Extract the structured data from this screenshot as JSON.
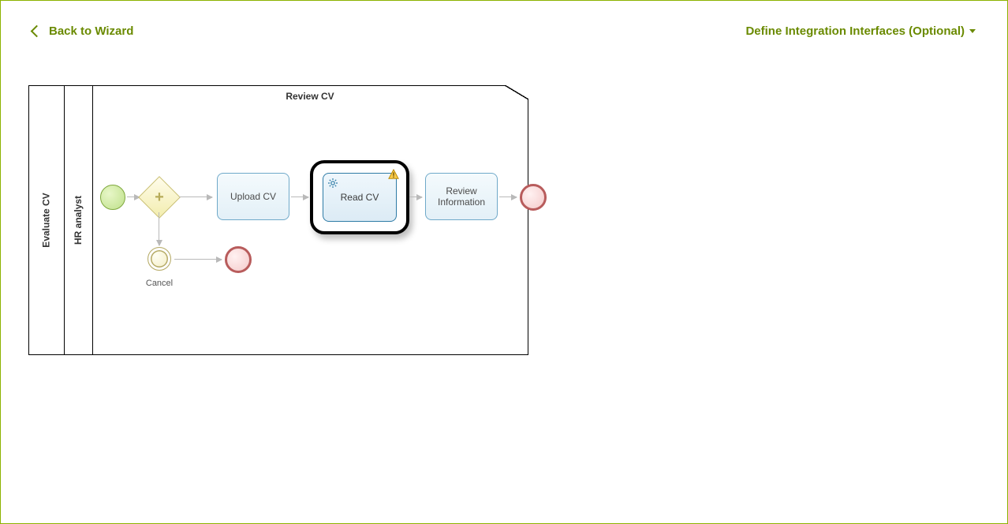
{
  "header": {
    "back_label": "Back to Wizard",
    "right_label": "Define Integration Interfaces (Optional)"
  },
  "diagram": {
    "pool_label": "Evaluate CV",
    "lane_label": "HR analyst",
    "lane_title": "Review CV",
    "tasks": {
      "upload": "Upload CV",
      "read": "Read CV",
      "review": "Review Information"
    },
    "events": {
      "cancel_label": "Cancel"
    }
  }
}
